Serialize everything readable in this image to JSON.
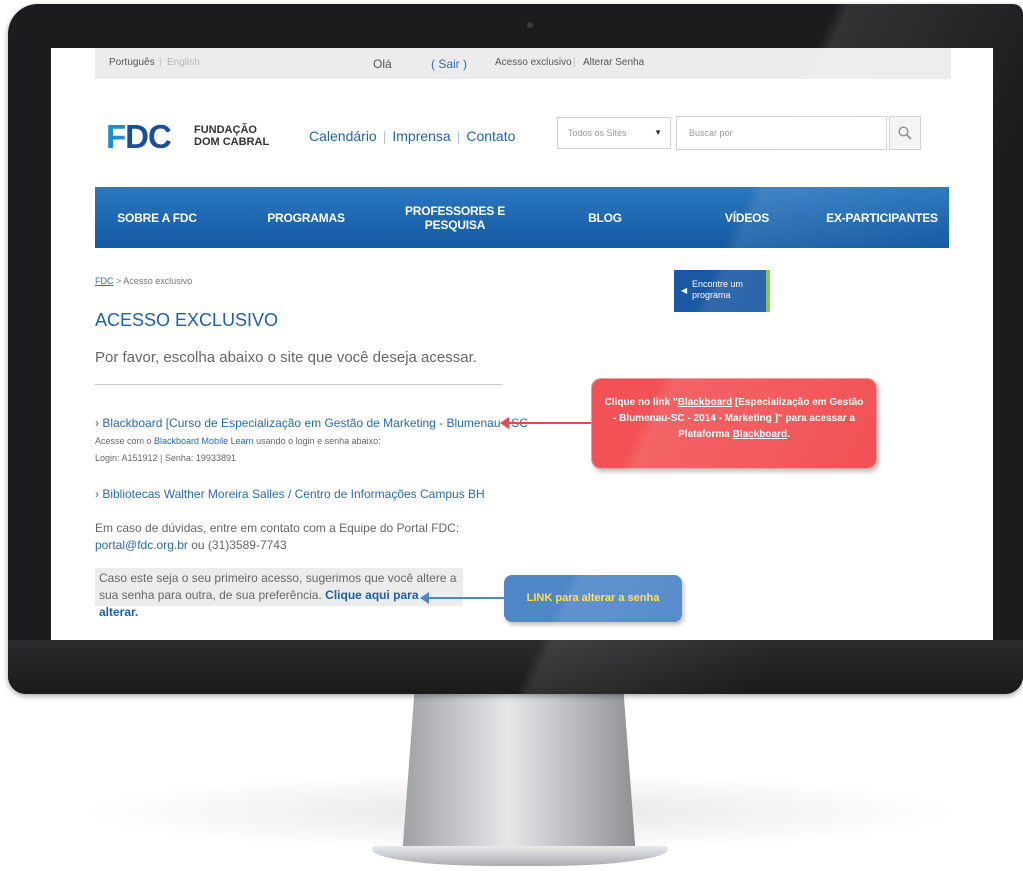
{
  "topbar": {
    "lang_pt": "Português",
    "lang_en": "English",
    "greeting": "Olá",
    "logout": "( Sair )",
    "exclusive": "Acesso exclusivo",
    "change_password": "Alterar Senha"
  },
  "header": {
    "logo_mark_f": "F",
    "logo_mark_dc": "DC",
    "logo_line1": "FUNDAÇÃO",
    "logo_line2": "DOM CABRAL",
    "quick_links": [
      "Calendário",
      "Imprensa",
      "Contato"
    ],
    "site_select": "Todos os Sites",
    "search_placeholder": "Buscar por"
  },
  "nav": {
    "items": [
      "SOBRE A FDC",
      "PROGRAMAS",
      "PROFESSORES E PESQUISA",
      "BLOG",
      "VÍDEOS",
      "EX-PARTICIPANTES"
    ]
  },
  "breadcrumb": {
    "home": "FDC",
    "sep": " > ",
    "current": "Acesso exclusivo"
  },
  "main": {
    "title": "ACESSO EXCLUSIVO",
    "intro": "Por favor, escolha abaixo o site que você deseja acessar.",
    "link1": "› Blackboard [Curso de Especialização em Gestão de Marketing - Blumenau - SC",
    "link1_note_pre": "Acesse com o ",
    "link1_note_link": "Blackboard Mobile Learn",
    "link1_note_post": " usando o login e senha abaixo:",
    "link1_login": "Login: A151912 | Senha: 19933891",
    "link2": "›  Bibliotecas Walther Moreira Salles / Centro de Informações Campus BH",
    "help_line1": "Em caso de dúvidas, entre em contato com a Equipe do Portal FDC:",
    "help_email": "portal@fdc.org.br",
    "help_or": " ou (31)3589-7743",
    "pwd_text": "Caso este seja o seu primeiro acesso, sugerimos que você altere a sua senha para outra, de sua preferência. ",
    "pwd_link": "Clique aqui para alterar."
  },
  "sidebar": {
    "find_program_line1": "Encontre um",
    "find_program_line2": "programa"
  },
  "callouts": {
    "red_1": "Clique no link \"",
    "red_link": "Blackboard",
    "red_2": " [Especialização  em Gestão - Blumenau-SC - 2014 - Marketing ]\"  para acessar a Plataforma ",
    "red_link2": "Blackboard",
    "red_3": ".",
    "blue": "LINK para alterar a senha"
  },
  "colors": {
    "brand_blue": "#1a58a3",
    "nav_blue": "#1f69b2",
    "callout_red": "#f25256",
    "callout_blue": "#4f86c8",
    "accent_green": "#7cc242"
  }
}
